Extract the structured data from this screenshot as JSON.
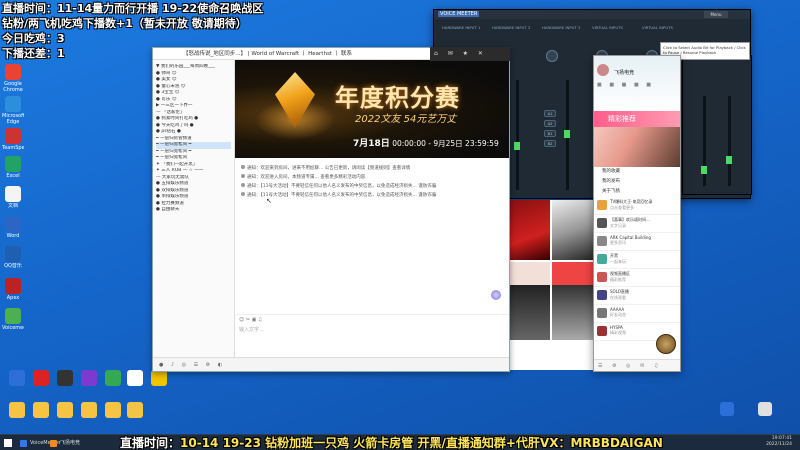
{
  "overlay": {
    "line1": "直播时间：11-14量力而行开播 19-22使命召唤战区",
    "line2": "钻粉/两飞机吃鸡下播数+1（暂未开放 敬请期待）",
    "line3": "今日吃鸡：3",
    "line4": "下播还差：1",
    "bottom_prefix": "直播时间：",
    "bottom_rest": "10-14 19-23 钻粉加班一只鸡 火箭卡房管 开黑/直播通知群+代肝VX：MRBBDAIGAN"
  },
  "desktop_icons": [
    {
      "label": "Google Chrome",
      "color": "#ea4335"
    },
    {
      "label": "Microsoft Edge",
      "color": "#2b8fdc"
    },
    {
      "label": "TeamSpeak",
      "color": "#c33"
    },
    {
      "label": "Excel",
      "color": "#21a366"
    },
    {
      "label": "文档",
      "color": "#f4f4f4"
    },
    {
      "label": "Word",
      "color": "#2b66c4"
    },
    {
      "label": "QQ音乐",
      "color": "#1f5fb2"
    },
    {
      "label": "Apex",
      "color": "#b22"
    },
    {
      "label": "Voicemeeter",
      "color": "#4caf50"
    }
  ],
  "chat_window": {
    "title": "【怒战传说_地区同步...】 | World of Warcraft 丨 Hearthst 丨 联系",
    "tree": [
      "▼ 我们的乐园___每周四晚___",
      "  ● 帅哥 😊",
      "  ● 美女 😊",
      "  ● 童心未泯 😊",
      "  ● 3宝宝 😊",
      "  ● 可乐 😊",
      "  ▶ 一三区一下界一",
      "  — 「话家伦」",
      "  ● 抓紧时间打吃鸡 ●",
      "  ● 今天吃鸡了吗 ●",
      "  ● ps钻石 ●",
      "  ━ 一层归房管频道",
      "  ━ 一层归宽松间 ━",
      "  ━ 一层归宽松间 ━",
      "  ━ 一层归宽松间",
      "  ✦ 「我们一起开黑」",
      "  ✦ 三人 ROB 一 ☆ 一一",
      "  — 大家玩无需队",
      "  ● 五排娱乐频道",
      "  ● 双排娱乐频道",
      "  ● 单排娱乐频道",
      "  ● 拉力赛频道",
      "  ● 自由聊天"
    ],
    "banner": {
      "title": "年度积分赛",
      "subtitle": "2022文友 54元艺万丈",
      "date_prefix": "7月18日",
      "date_rest": "00:00:00 - 9月25日 23:59:59"
    },
    "messages": [
      "通知：欢迎来到房间，进来不用尬聊... 公告已更新，请阅读【频道规则】查看详情",
      "通知：欢迎进入房间，本频道专属... 查看更多精彩活动内容",
      "通知：【11号大活动】不要轻信任何以他人名义发布的中奖信息，以免造成经济损失... 谨防诈骗",
      "通知：【11号大活动】不要轻信任何以他人名义发布的中奖信息，以免造成经济损失... 谨防诈骗"
    ],
    "input_placeholder": "输入文字..."
  },
  "voicemeeter": {
    "brand": "VOICE MEETER",
    "strips": [
      "HARDWARE INPUT 1",
      "HARDWARE INPUT 2",
      "HARDWARE INPUT 3",
      "VIRTUAL INPUTS",
      "VIRTUAL INPUTS"
    ],
    "menu_label": "Menu"
  },
  "qq_panel": {
    "name": "飞扬电竞",
    "banner": "精彩推荐",
    "menu_items": [
      "我的收藏",
      "我的发布",
      "关于飞扬"
    ],
    "list": [
      {
        "title": "TV爆料大王·电竞回忆录",
        "sub": "点击查看更多",
        "color": "#e8a23a"
      },
      {
        "title": "【喜事】欢乐颂时间...",
        "sub": "文字记录",
        "color": "#555"
      },
      {
        "title": "ARK Capital Building",
        "sub": "更多资讯",
        "color": "#888"
      },
      {
        "title": "开黑",
        "sub": "一起来玩",
        "color": "#4a9"
      },
      {
        "title": "视频直播区",
        "sub": "精彩推荐",
        "color": "#c55"
      },
      {
        "title": "SOLO直播",
        "sub": "在线观看",
        "color": "#448"
      },
      {
        "title": "AAAAA",
        "sub": "好友动态",
        "color": "#777"
      },
      {
        "title": "HYSPA",
        "sub": "精彩视频",
        "color": "#933"
      }
    ]
  },
  "mini_tip": "Click to Select Audio Bit for Playback / Click to Pause / Resume Playback",
  "taskbar": {
    "items": [
      {
        "label": "VoiceMeeter",
        "color": "#2d7be5"
      },
      {
        "label": "飞扬电竞",
        "color": "#f08a24"
      }
    ],
    "time": "19:07:41",
    "date": "2022/11/24"
  }
}
